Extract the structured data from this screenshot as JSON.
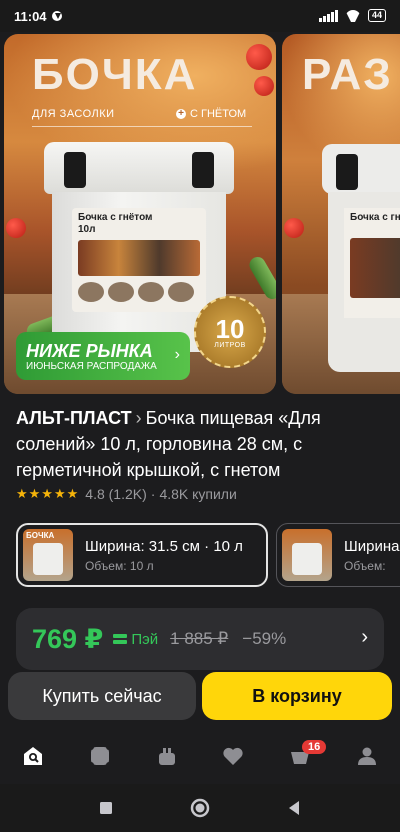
{
  "status_bar": {
    "time": "11:04",
    "battery": "44"
  },
  "carousel": {
    "slide1": {
      "title": "БОЧКА",
      "sub_left": "ДЛЯ ЗАСОЛКИ",
      "sub_right": "С ГНЁТОМ",
      "label_line1": "Бочка с гнётом",
      "label_line2": "10л",
      "badge_number": "10",
      "badge_unit": "ЛИТРОВ",
      "promo_title": "НИЖЕ РЫНКА",
      "promo_subtitle": "ИЮНЬСКАЯ РАСПРОДАЖА"
    },
    "slide2": {
      "title": "РАЗ",
      "label_line1": "Бочка с гнётом"
    }
  },
  "product": {
    "brand": "АЛЬТ-ПЛАСТ",
    "title": "Бочка пищевая «Для солений» 10 л, горловина 28 см, с герметичной крышкой, с гнетом",
    "stars": "★★★★★",
    "rating": "4.8 (1.2K)",
    "separator": "·",
    "purchases": "4.8K купили"
  },
  "variants": [
    {
      "thumb_text": "БОЧКА",
      "main": "Ширина: 31.5 см · 10 л",
      "sub": "Объем: 10 л"
    },
    {
      "thumb_text": "",
      "main": "Ширина",
      "sub": "Объем:"
    }
  ],
  "price": {
    "current": "769 ₽",
    "pay_label": "Пэй",
    "old": "1 885 ₽",
    "discount": "−59%"
  },
  "buttons": {
    "buy_now": "Купить сейчас",
    "add_to_cart": "В корзину"
  },
  "bottom_nav": {
    "cart_badge": "16",
    "icons": [
      "home-search-icon",
      "catalog-icon",
      "bag-icon",
      "heart-icon",
      "cart-icon",
      "profile-icon"
    ]
  },
  "colors": {
    "price_green": "#34c759",
    "cart_yellow": "#ffd60a",
    "star_gold": "#f5b30a",
    "badge_red": "#e53935"
  }
}
